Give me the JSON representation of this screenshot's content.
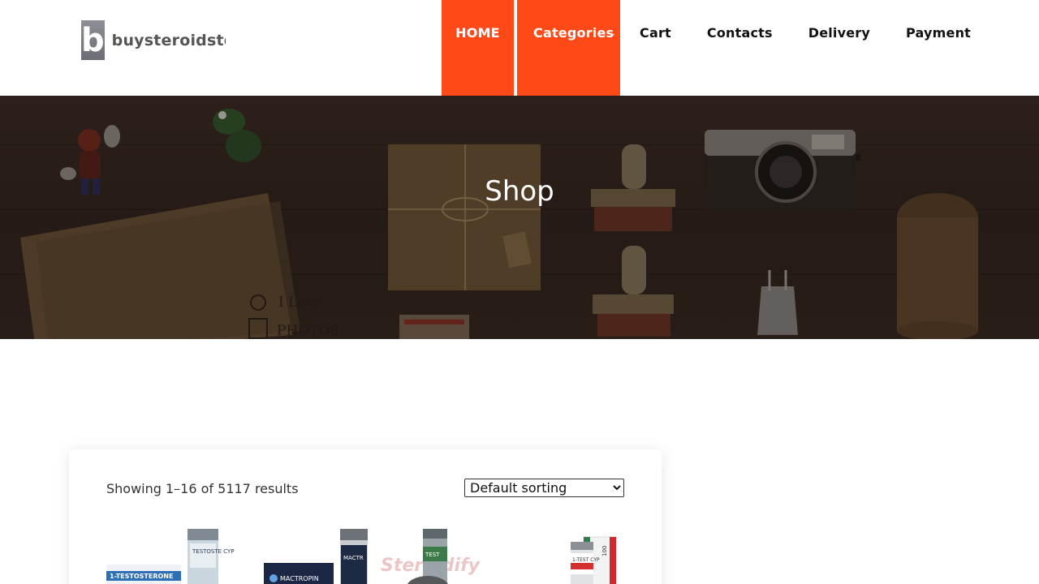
{
  "header": {
    "logo_mark": "b",
    "logo_text": "buysteroidsto",
    "nav": [
      {
        "label": "HOME"
      },
      {
        "label": "Categories"
      },
      {
        "label": "Cart"
      },
      {
        "label": "Contacts"
      },
      {
        "label": "Delivery"
      },
      {
        "label": "Payment"
      }
    ],
    "chevron": "⌄"
  },
  "hero": {
    "title": "Shop",
    "envelope_text_1": "I Love",
    "envelope_text_2": "PHOTOS"
  },
  "shop": {
    "result_count": "Showing 1–16 of 5117 results",
    "sort_selected": "Default sorting",
    "products": [
      {
        "label_1": "1-TESTOSTERONE",
        "label_2": "TESTOSTE CYP"
      },
      {
        "label_1": "MACTROPIN",
        "label_2": "MACTR"
      },
      {
        "label_1": "Steroidify",
        "label_2": "TEST"
      },
      {
        "label_1": "1-TEST CYP",
        "label_2": "100"
      }
    ]
  },
  "colors": {
    "accent": "#ff4a17",
    "hero_bg": "#33251e",
    "text": "#222222"
  }
}
